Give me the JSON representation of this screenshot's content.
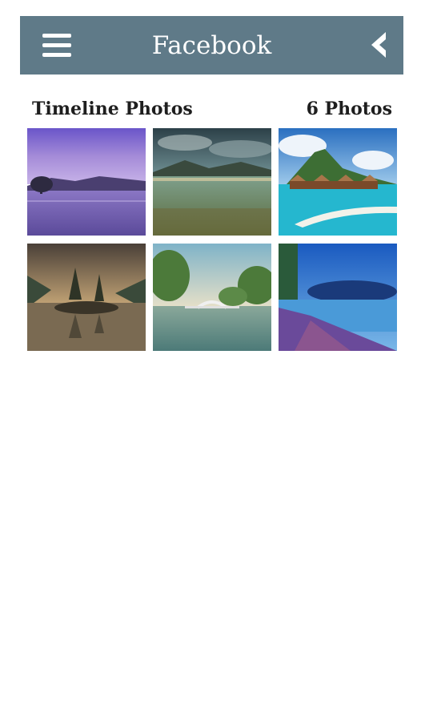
{
  "header": {
    "title": "Facebook",
    "background_color": "#5f7a88",
    "menu_icon": "hamburger-menu-icon",
    "back_icon": "chevron-left-icon"
  },
  "album": {
    "title": "Timeline Photos",
    "count_label": "6 Photos",
    "photos": [
      {
        "name": "purple-lake-tree"
      },
      {
        "name": "cloudy-lagoon-shore"
      },
      {
        "name": "tropical-overwater-bungalows"
      },
      {
        "name": "mountain-lake-trees-reflection"
      },
      {
        "name": "lake-bridge-park"
      },
      {
        "name": "blue-river-path"
      }
    ]
  }
}
